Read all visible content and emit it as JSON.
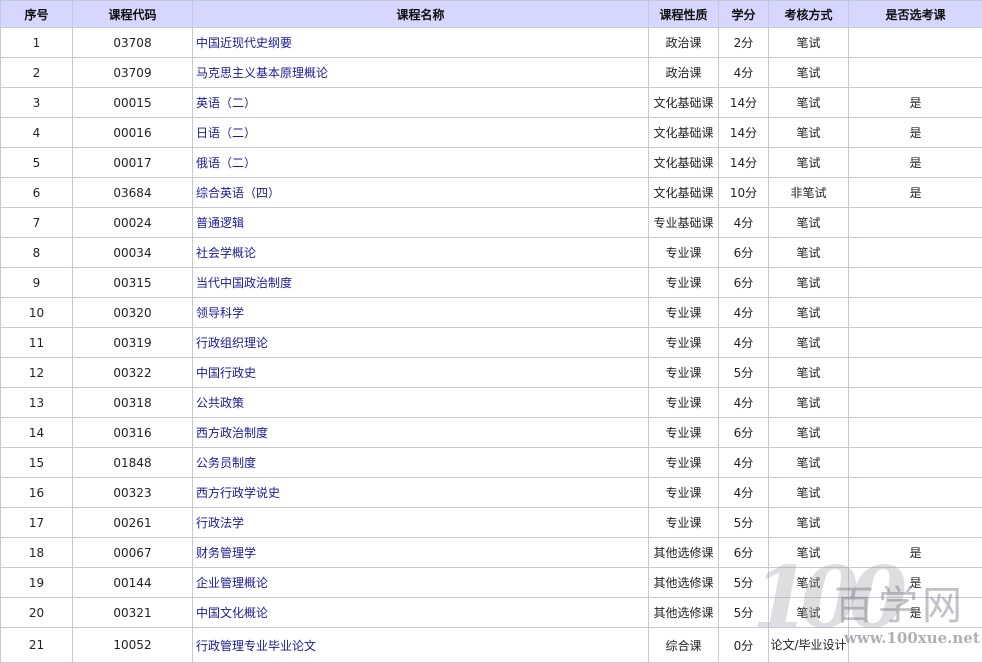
{
  "table": {
    "headers": [
      "序号",
      "课程代码",
      "课程名称",
      "课程性质",
      "学分",
      "考核方式",
      "是否选考课"
    ],
    "rows": [
      [
        "1",
        "03708",
        "中国近现代史纲要",
        "政治课",
        "2分",
        "笔试",
        ""
      ],
      [
        "2",
        "03709",
        "马克思主义基本原理概论",
        "政治课",
        "4分",
        "笔试",
        ""
      ],
      [
        "3",
        "00015",
        "英语（二）",
        "文化基础课",
        "14分",
        "笔试",
        "是"
      ],
      [
        "4",
        "00016",
        "日语（二）",
        "文化基础课",
        "14分",
        "笔试",
        "是"
      ],
      [
        "5",
        "00017",
        "俄语（二）",
        "文化基础课",
        "14分",
        "笔试",
        "是"
      ],
      [
        "6",
        "03684",
        "综合英语（四）",
        "文化基础课",
        "10分",
        "非笔试",
        "是"
      ],
      [
        "7",
        "00024",
        "普通逻辑",
        "专业基础课",
        "4分",
        "笔试",
        ""
      ],
      [
        "8",
        "00034",
        "社会学概论",
        "专业课",
        "6分",
        "笔试",
        ""
      ],
      [
        "9",
        "00315",
        "当代中国政治制度",
        "专业课",
        "6分",
        "笔试",
        ""
      ],
      [
        "10",
        "00320",
        "领导科学",
        "专业课",
        "4分",
        "笔试",
        ""
      ],
      [
        "11",
        "00319",
        "行政组织理论",
        "专业课",
        "4分",
        "笔试",
        ""
      ],
      [
        "12",
        "00322",
        "中国行政史",
        "专业课",
        "5分",
        "笔试",
        ""
      ],
      [
        "13",
        "00318",
        "公共政策",
        "专业课",
        "4分",
        "笔试",
        ""
      ],
      [
        "14",
        "00316",
        "西方政治制度",
        "专业课",
        "6分",
        "笔试",
        ""
      ],
      [
        "15",
        "01848",
        "公务员制度",
        "专业课",
        "4分",
        "笔试",
        ""
      ],
      [
        "16",
        "00323",
        "西方行政学说史",
        "专业课",
        "4分",
        "笔试",
        ""
      ],
      [
        "17",
        "00261",
        "行政法学",
        "专业课",
        "5分",
        "笔试",
        ""
      ],
      [
        "18",
        "00067",
        "财务管理学",
        "其他选修课",
        "6分",
        "笔试",
        "是"
      ],
      [
        "19",
        "00144",
        "企业管理概论",
        "其他选修课",
        "5分",
        "笔试",
        "是"
      ],
      [
        "20",
        "00321",
        "中国文化概论",
        "其他选修课",
        "5分",
        "笔试",
        "是"
      ],
      [
        "21",
        "10052",
        "行政管理专业毕业论文",
        "综合课",
        "0分",
        "论文/毕业设计",
        ""
      ]
    ]
  },
  "watermark": {
    "logo": "100",
    "site_name": "百学网",
    "url": "www.100xue.net"
  },
  "colors": {
    "header_bg": "#d6d6ff",
    "link": "#1a1a9a",
    "border": "#c8c8d8"
  }
}
